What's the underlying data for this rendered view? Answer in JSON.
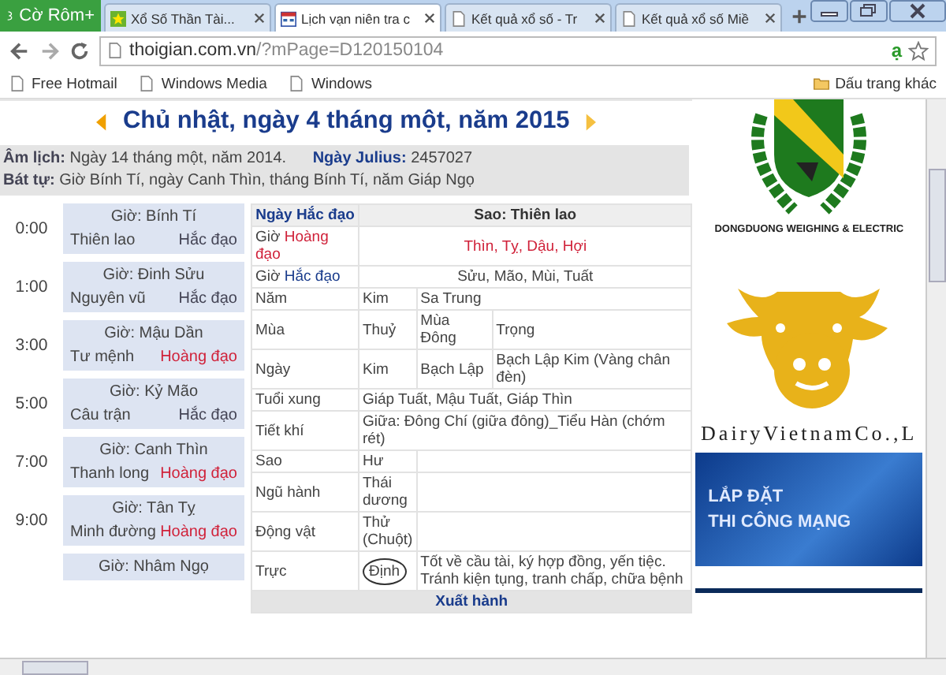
{
  "browser": {
    "menu_label": "Cờ Rôm+",
    "tabs": [
      {
        "label": "Xổ Số Thần Tài...",
        "selected": false,
        "kind": "star"
      },
      {
        "label": "Lịch vạn niên tra c",
        "selected": true,
        "kind": "calendar"
      },
      {
        "label": "Kết quả xổ số - Tr",
        "selected": false,
        "kind": "page"
      },
      {
        "label": "Kết quả xổ số Miề",
        "selected": false,
        "kind": "page"
      }
    ],
    "url_host": "thoigian.com.vn",
    "url_path": "/?mPage=D120150104",
    "extension_glyph": "ạ",
    "bookmarks": [
      "Free Hotmail",
      "Windows Media",
      "Windows"
    ],
    "other_bookmarks": "Dấu trang khác"
  },
  "page": {
    "date_title": "Chủ nhật, ngày 4 tháng một, năm 2015",
    "lunar_label": "Âm lịch:",
    "lunar_text": "Ngày 14 tháng một, năm 2014.",
    "julius_label": "Ngày Julius:",
    "julius_value": "2457027",
    "bat_tu_label": "Bát tự:",
    "bat_tu_text": "Giờ Bính Tí, ngày Canh Thìn, tháng Bính Tí, năm Giáp Ngọ",
    "hours": [
      {
        "time": "0:00",
        "name": "Giờ: Bính Tí",
        "star": "Thiên lao",
        "type_label": "Hắc đạo",
        "kind": "hac"
      },
      {
        "time": "1:00",
        "name": "Giờ: Đinh Sửu",
        "star": "Nguyên vũ",
        "type_label": "Hắc đạo",
        "kind": "hac"
      },
      {
        "time": "3:00",
        "name": "Giờ: Mậu Dần",
        "star": "Tư mệnh",
        "type_label": "Hoàng đạo",
        "kind": "hoang"
      },
      {
        "time": "5:00",
        "name": "Giờ: Kỷ Mão",
        "star": "Câu trận",
        "type_label": "Hắc đạo",
        "kind": "hac"
      },
      {
        "time": "7:00",
        "name": "Giờ: Canh Thìn",
        "star": "Thanh long",
        "type_label": "Hoàng đạo",
        "kind": "hoang"
      },
      {
        "time": "9:00",
        "name": "Giờ: Tân Tỵ",
        "star": "Minh đường",
        "type_label": "Hoàng đạo",
        "kind": "hoang"
      },
      {
        "name": "Giờ: Nhâm Ngọ"
      }
    ],
    "table": [
      {
        "kind": "header",
        "cells": [
          {
            "text": "Ngày Hắc đạo"
          },
          {
            "text": "Sao: Thiên lao"
          }
        ]
      },
      {
        "kind": "hours",
        "cells": [
          {
            "prefix": "Giờ",
            "text": "Hoàng đạo",
            "color": "#d0223a"
          },
          {
            "text": "Thìn, Tỵ, Dậu, Hợi",
            "color": "#d0223a"
          }
        ]
      },
      {
        "kind": "hours",
        "cells": [
          {
            "prefix": "Giờ",
            "text": "Hắc đạo",
            "color": "#1a3c8c"
          },
          {
            "text": "Sửu, Mão, Mùi, Tuất"
          }
        ]
      },
      {
        "kind": "row",
        "cells": [
          {
            "text": "Năm"
          },
          {
            "text": "Kim"
          },
          {
            "text": "Sa Trung"
          }
        ]
      },
      {
        "kind": "row",
        "cells": [
          {
            "text": "Mùa"
          },
          {
            "text": "Thuỷ"
          },
          {
            "text": "Mùa Đông"
          },
          {
            "text": "Trọng"
          }
        ]
      },
      {
        "kind": "row",
        "cells": [
          {
            "text": "Ngày"
          },
          {
            "text": "Kim"
          },
          {
            "text": "Bạch Lập"
          },
          {
            "text": "Bạch Lập Kim (Vàng chân đèn)"
          }
        ]
      },
      {
        "kind": "row",
        "cells": [
          {
            "text": "Tuổi xung"
          },
          {
            "text": "Giáp Tuất, Mậu Tuất, Giáp Thìn"
          }
        ]
      },
      {
        "kind": "row",
        "cells": [
          {
            "text": "Tiết khí"
          },
          {
            "text": "Giữa: Đông Chí (giữa đông)_Tiểu Hàn (chớm rét)"
          }
        ]
      },
      {
        "kind": "pair",
        "cells": [
          {
            "text": "Sao"
          },
          {
            "text": "Hư"
          }
        ]
      },
      {
        "kind": "pair",
        "cells": [
          {
            "text": "Ngũ hành"
          },
          {
            "text": "Thái dương"
          }
        ]
      },
      {
        "kind": "pair",
        "cells": [
          {
            "text": "Động vật"
          },
          {
            "text": "Thử (Chuột)"
          }
        ]
      },
      {
        "kind": "row",
        "cells": [
          {
            "text": "Trực"
          },
          {
            "text": "Định",
            "circled": true
          },
          {
            "text": "Tốt về cầu tài, ký hợp đồng, yến tiệc. Tránh kiện tụng, tranh chấp, chữa bệnh"
          }
        ]
      },
      {
        "kind": "section",
        "cells": [
          {
            "text": "Xuất hành"
          }
        ]
      }
    ]
  },
  "ads": {
    "logo_caption": "DONGDUONG WEIGHING & ELECTRIC",
    "dairy_caption": "DairyVietnamCo.,L",
    "banner_lines": [
      "LẮP ĐẶT",
      "THI CÔNG MẠNG"
    ]
  }
}
